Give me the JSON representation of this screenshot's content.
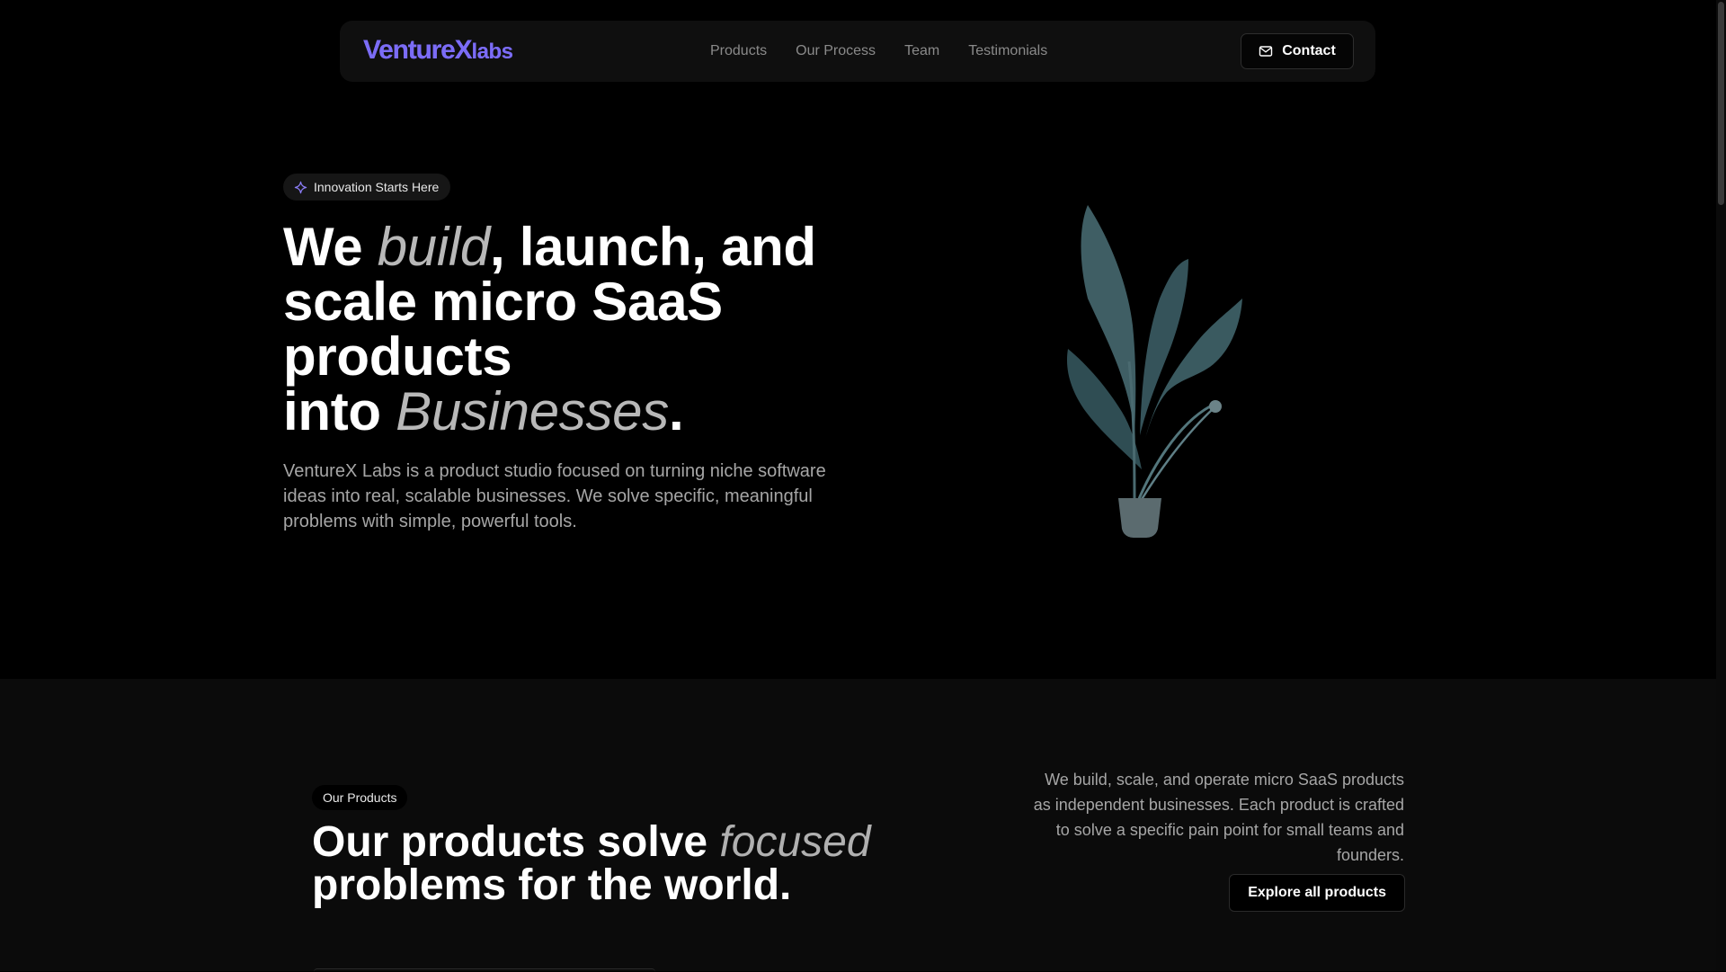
{
  "nav": {
    "logo_main": "VentureX",
    "logo_sub": "labs",
    "links": [
      "Products",
      "Our Process",
      "Team",
      "Testimonials"
    ],
    "contact_label": "Contact"
  },
  "hero": {
    "badge": "Innovation Starts Here",
    "title": {
      "p1": "We ",
      "p2": "build",
      "p3": ", launch, and scale micro SaaS products",
      "p4": "into ",
      "p5": "Businesses",
      "p6": "."
    },
    "description": "VentureX Labs is a product studio focused on turning niche software ideas into real, scalable businesses. We solve specific, meaningful problems with simple, powerful tools."
  },
  "products_section": {
    "badge": "Our Products",
    "title": {
      "p1": "Our products solve ",
      "p2": "focused",
      "p3": "problems for the world."
    },
    "description": "We build, scale, and operate micro SaaS products as independent businesses. Each product is crafted to solve a specific pain point for small teams and founders.",
    "explore_label": "Explore all products"
  },
  "colors": {
    "accent": "#7b6cf6",
    "plant": "#3f5c62"
  }
}
